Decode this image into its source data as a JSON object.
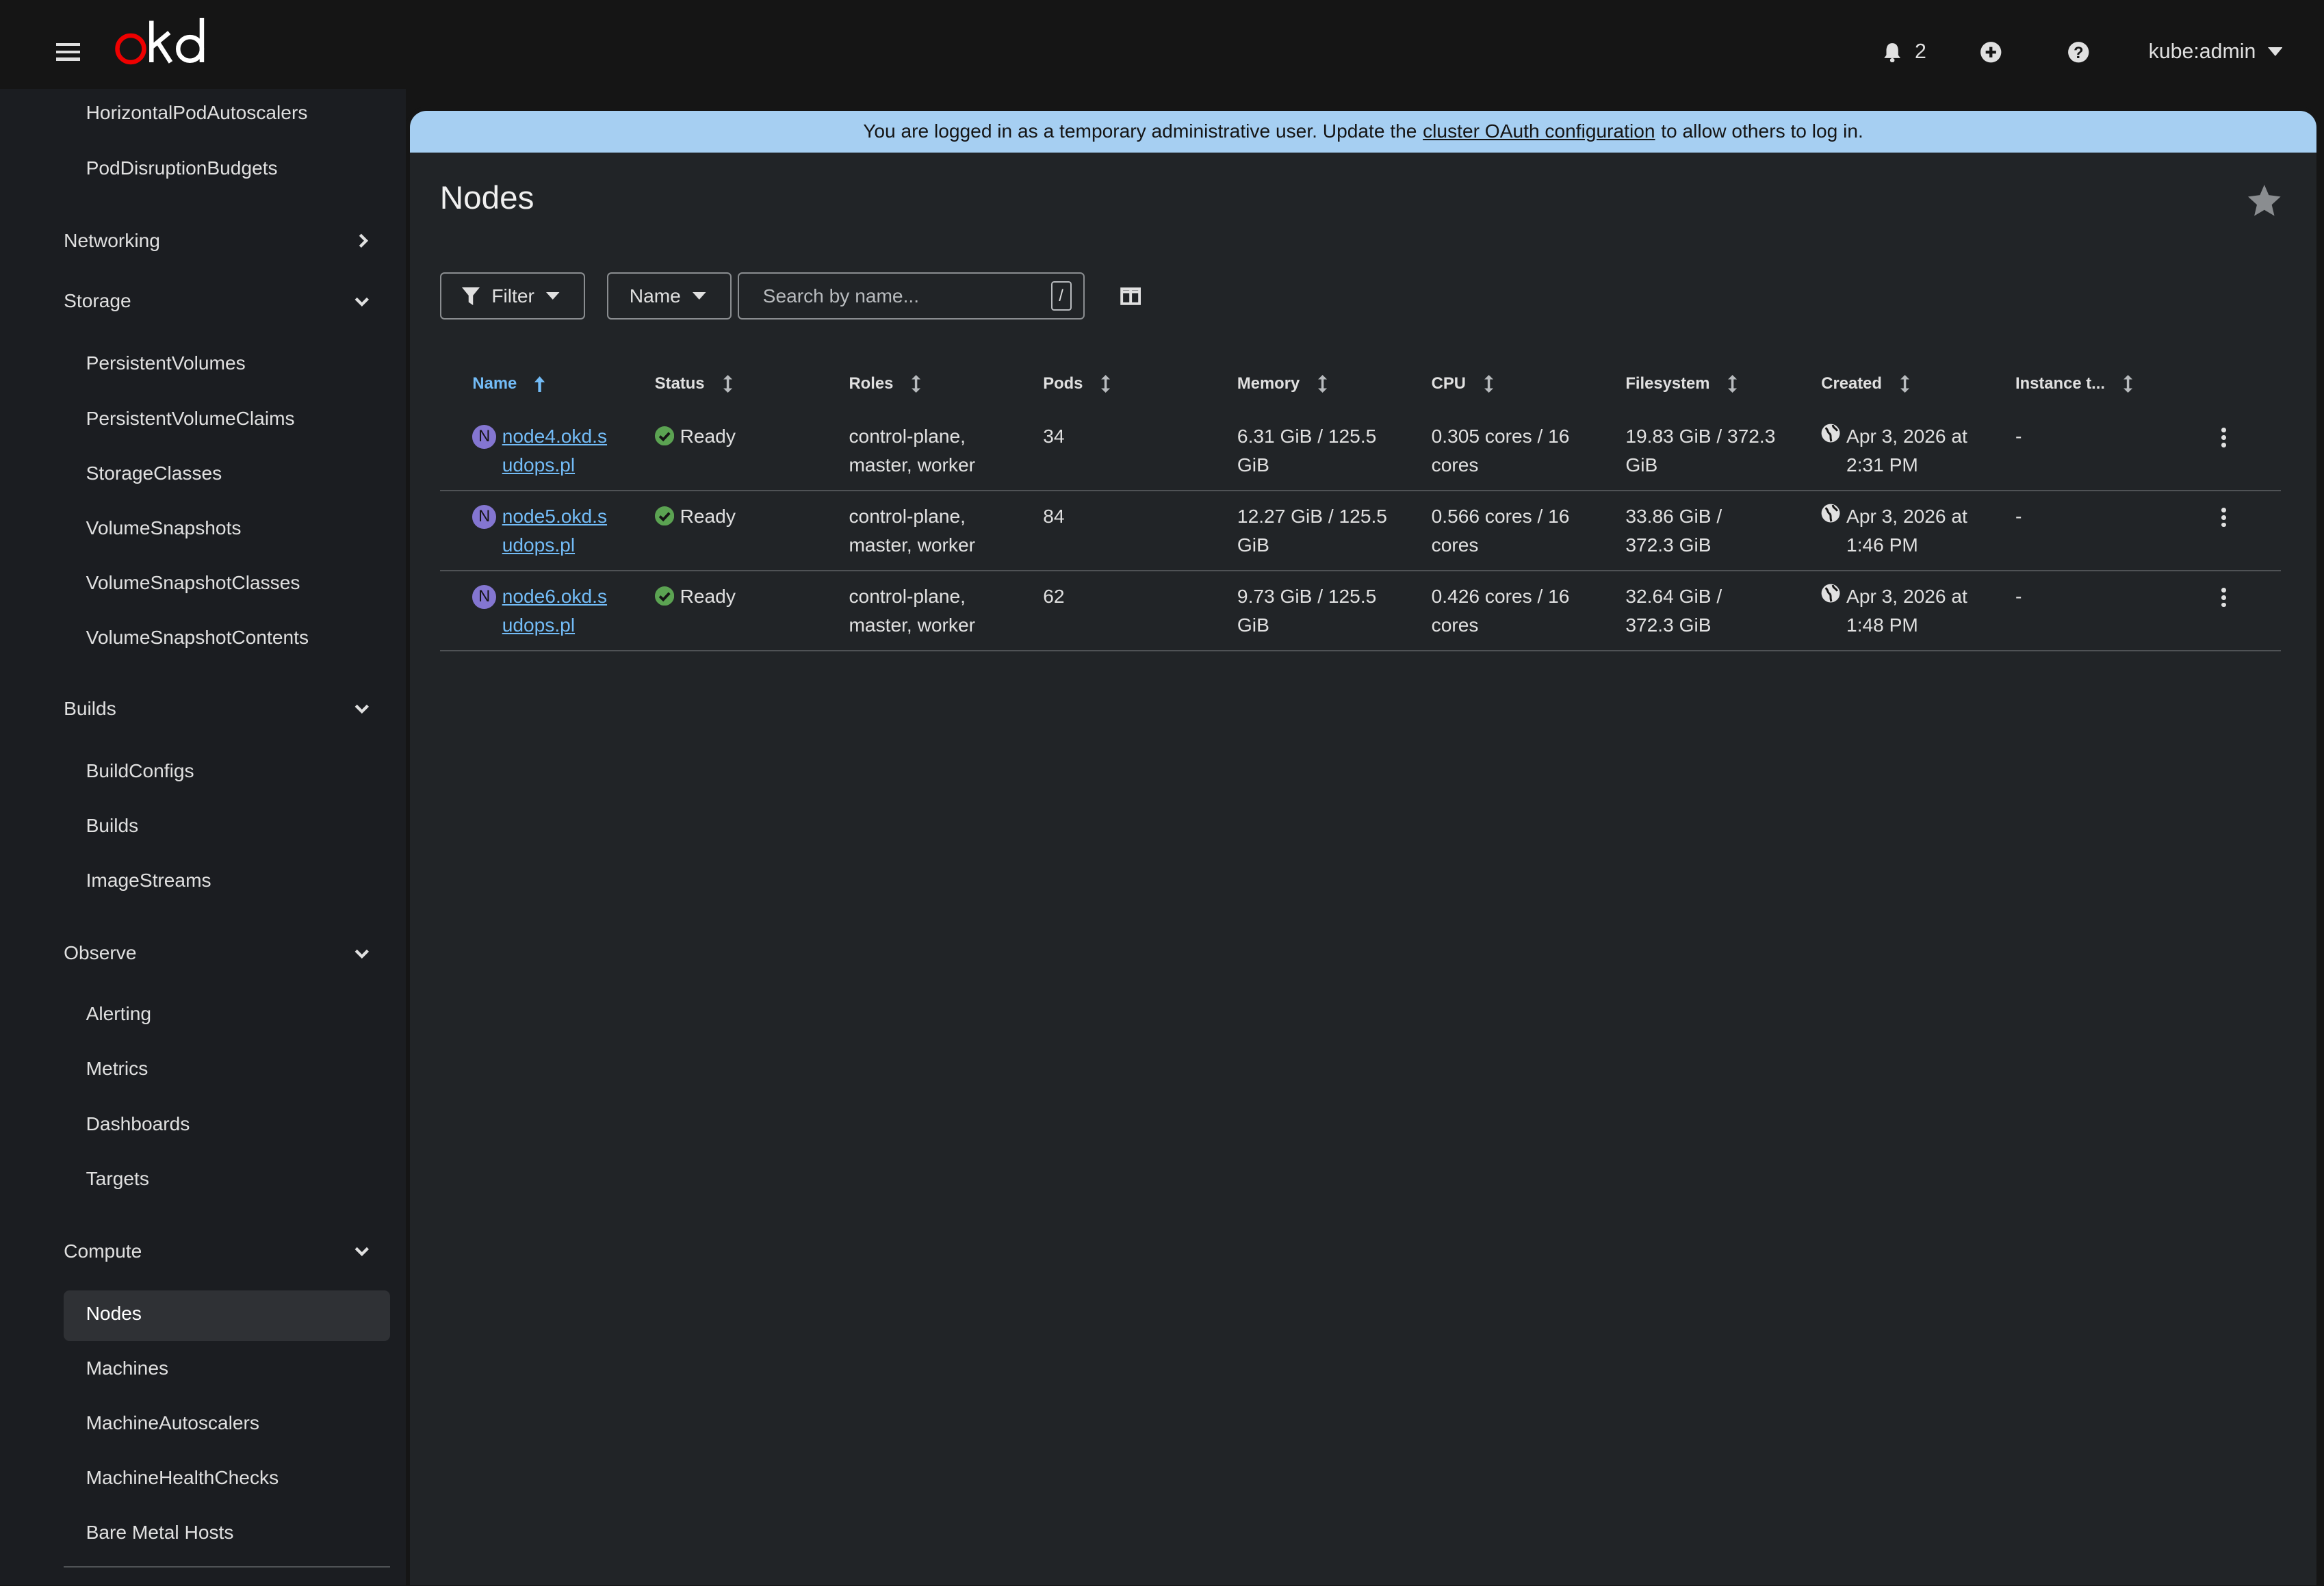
{
  "masthead": {
    "logo_text": "okd",
    "notifications_count": "2",
    "user": "kube:admin"
  },
  "sidebar": {
    "items_top": [
      "HorizontalPodAutoscalers",
      "PodDisruptionBudgets"
    ],
    "networking": "Networking",
    "storage": {
      "label": "Storage",
      "items": [
        "PersistentVolumes",
        "PersistentVolumeClaims",
        "StorageClasses",
        "VolumeSnapshots",
        "VolumeSnapshotClasses",
        "VolumeSnapshotContents"
      ]
    },
    "builds": {
      "label": "Builds",
      "items": [
        "BuildConfigs",
        "Builds",
        "ImageStreams"
      ]
    },
    "observe": {
      "label": "Observe",
      "items": [
        "Alerting",
        "Metrics",
        "Dashboards",
        "Targets"
      ]
    },
    "compute": {
      "label": "Compute",
      "items": [
        "Nodes",
        "Machines",
        "MachineAutoscalers",
        "MachineHealthChecks",
        "Bare Metal Hosts"
      ]
    }
  },
  "banner": {
    "before": "You are logged in as a temporary administrative user. Update the",
    "link": "cluster OAuth configuration",
    "after": "to allow others to log in."
  },
  "page": {
    "title": "Nodes"
  },
  "toolbar": {
    "filter_label": "Filter",
    "name_label": "Name",
    "search_placeholder": "Search by name...",
    "slash": "/"
  },
  "table": {
    "headers": [
      "Name",
      "Status",
      "Roles",
      "Pods",
      "Memory",
      "CPU",
      "Filesystem",
      "Created",
      "Instance t..."
    ],
    "rows": [
      {
        "badge": "N",
        "name": "node4.okd.sudops.pl",
        "status": "Ready",
        "roles": "control-plane, master, worker",
        "pods": "34",
        "memory": "6.31 GiB / 125.5 GiB",
        "cpu": "0.305 cores / 16 cores",
        "filesystem": "19.83 GiB / 372.3 GiB",
        "created": "Apr 3, 2026 at 2:31 PM",
        "instance": "-"
      },
      {
        "badge": "N",
        "name": "node5.okd.sudops.pl",
        "status": "Ready",
        "roles": "control-plane, master, worker",
        "pods": "84",
        "memory": "12.27 GiB / 125.5 GiB",
        "cpu": "0.566 cores / 16 cores",
        "filesystem": "33.86 GiB / 372.3 GiB",
        "created": "Apr 3, 2026 at 1:46 PM",
        "instance": "-"
      },
      {
        "badge": "N",
        "name": "node6.okd.sudops.pl",
        "status": "Ready",
        "roles": "control-plane, master, worker",
        "pods": "62",
        "memory": "9.73 GiB / 125.5 GiB",
        "cpu": "0.426 cores / 16 cores",
        "filesystem": "32.64 GiB / 372.3 GiB",
        "created": "Apr 3, 2026 at 1:48 PM",
        "instance": "-"
      }
    ]
  },
  "colors": {
    "accent": "#73bcf7",
    "banner": "#a6cff2",
    "ready": "#3e8635",
    "logo_red": "#ee0000"
  },
  "icons": [
    "hamburger-icon",
    "bell-icon",
    "plus-circle-icon",
    "help-icon",
    "caret-down-icon",
    "star-icon",
    "filter-icon",
    "columns-icon",
    "sort-icon",
    "check-circle-icon",
    "globe-icon",
    "kebab-icon",
    "chevron-right-icon",
    "chevron-down-icon"
  ]
}
